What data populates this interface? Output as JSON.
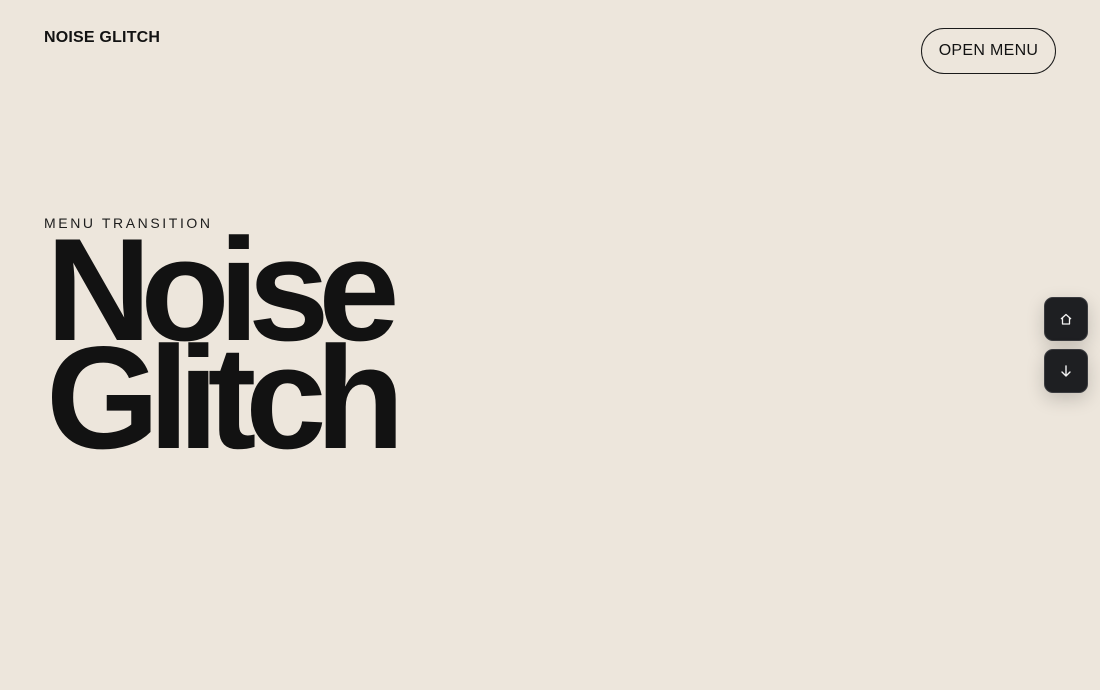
{
  "header": {
    "brand": "NOISE GLITCH",
    "menu_button_label": "OPEN MENU"
  },
  "hero": {
    "eyebrow": "MENU TRANSITION",
    "title_lines": [
      "Noise",
      "Glitch"
    ]
  },
  "side_nav": {
    "items": [
      {
        "icon": "home-icon"
      },
      {
        "icon": "arrow-down-icon"
      }
    ]
  },
  "colors": {
    "background": "#ede6dc",
    "text": "#121212",
    "side_button": "#1e1f22"
  }
}
